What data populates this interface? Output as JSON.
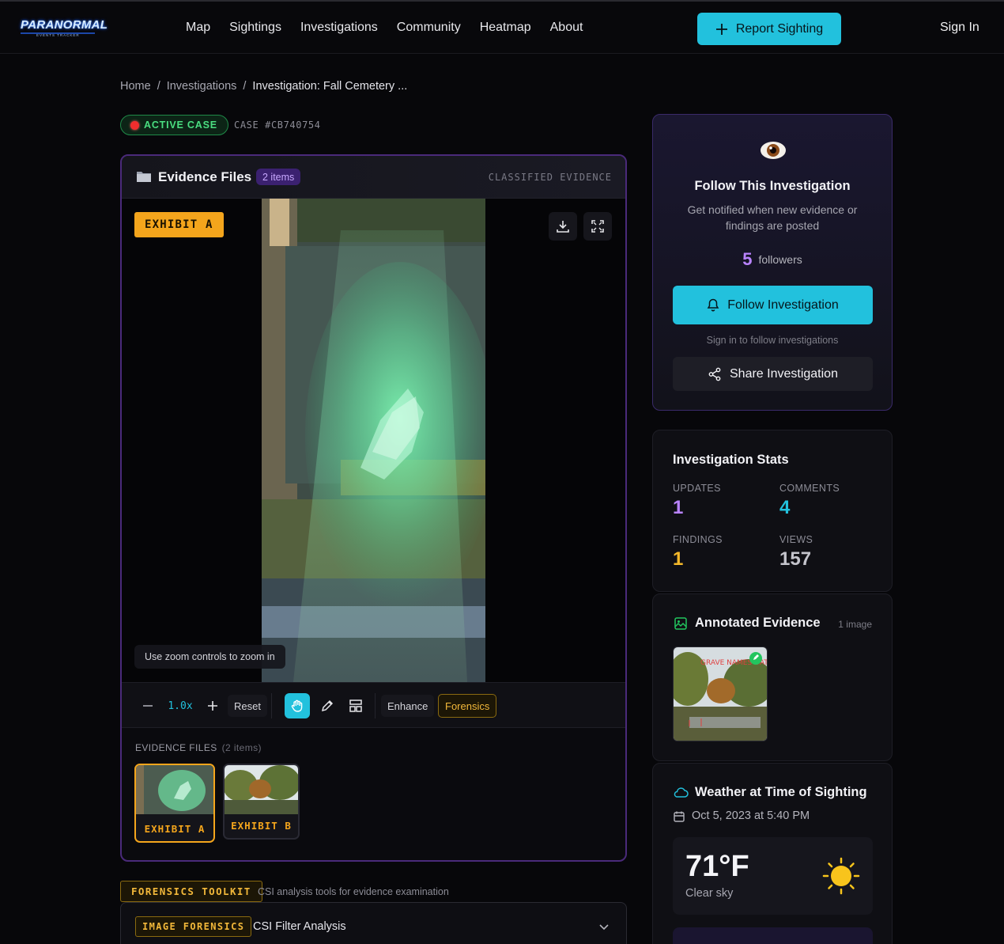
{
  "brand": {
    "name": "PARANORMAL",
    "tagline": "EVENTS TRACKER"
  },
  "nav": {
    "links": [
      "Map",
      "Sightings",
      "Investigations",
      "Community",
      "Heatmap",
      "About"
    ],
    "report_label": "Report Sighting",
    "signin_label": "Sign In"
  },
  "breadcrumb": {
    "home": "Home",
    "section": "Investigations",
    "current": "Investigation: Fall Cemetery ..."
  },
  "case": {
    "status": "ACTIVE CASE",
    "id": "CASE #CB740754"
  },
  "evidence": {
    "title": "Evidence Files",
    "items_badge": "2 items",
    "classified": "CLASSIFIED EVIDENCE",
    "exhibit_tag": "EXHIBIT A",
    "zoom_hint": "Use zoom controls to zoom in",
    "zoom_level": "1.0x",
    "reset_label": "Reset",
    "enhance_label": "Enhance",
    "forensics_label": "Forensics",
    "files_label": "EVIDENCE FILES",
    "files_count": "(2 items)",
    "thumbs": [
      {
        "label": "EXHIBIT A"
      },
      {
        "label": "EXHIBIT B"
      }
    ]
  },
  "forensics": {
    "badge": "FORENSICS TOOLKIT",
    "desc": "CSI analysis tools for evidence examination",
    "image_badge": "IMAGE FORENSICS",
    "title": "CSI Filter Analysis"
  },
  "follow": {
    "title": "Follow This Investigation",
    "desc": "Get notified when new evidence or findings are posted",
    "followers_count": "5",
    "followers_label": "followers",
    "follow_btn": "Follow Investigation",
    "signin_note": "Sign in to follow investigations",
    "share_btn": "Share Investigation"
  },
  "stats": {
    "title": "Investigation Stats",
    "items": [
      {
        "label": "UPDATES",
        "value": "1",
        "color": "#b983ff"
      },
      {
        "label": "COMMENTS",
        "value": "4",
        "color": "#22c1dd"
      },
      {
        "label": "FINDINGS",
        "value": "1",
        "color": "#f4b82a"
      },
      {
        "label": "VIEWS",
        "value": "157",
        "color": "#c4c4cc"
      }
    ]
  },
  "annotated": {
    "title": "Annotated Evidence",
    "count": "1 image",
    "overlay_text": "GRAVE NAMES DATES?"
  },
  "weather": {
    "title": "Weather at Time of Sighting",
    "date": "Oct 5, 2023 at 5:40 PM",
    "temp": "71°F",
    "condition": "Clear sky"
  },
  "colors": {
    "accent": "#22c1dd",
    "purple": "#b983ff",
    "amber": "#f4a51c",
    "green": "#4ade80"
  },
  "icons": [
    "plus-icon",
    "folder-icon",
    "download-icon",
    "fullscreen-icon",
    "minus-icon",
    "hand-icon",
    "pencil-icon",
    "layout-icon",
    "chevron-down-icon",
    "eye-icon",
    "bell-icon",
    "share-icon",
    "image-icon",
    "cloud-icon",
    "calendar-icon",
    "sun-icon"
  ]
}
